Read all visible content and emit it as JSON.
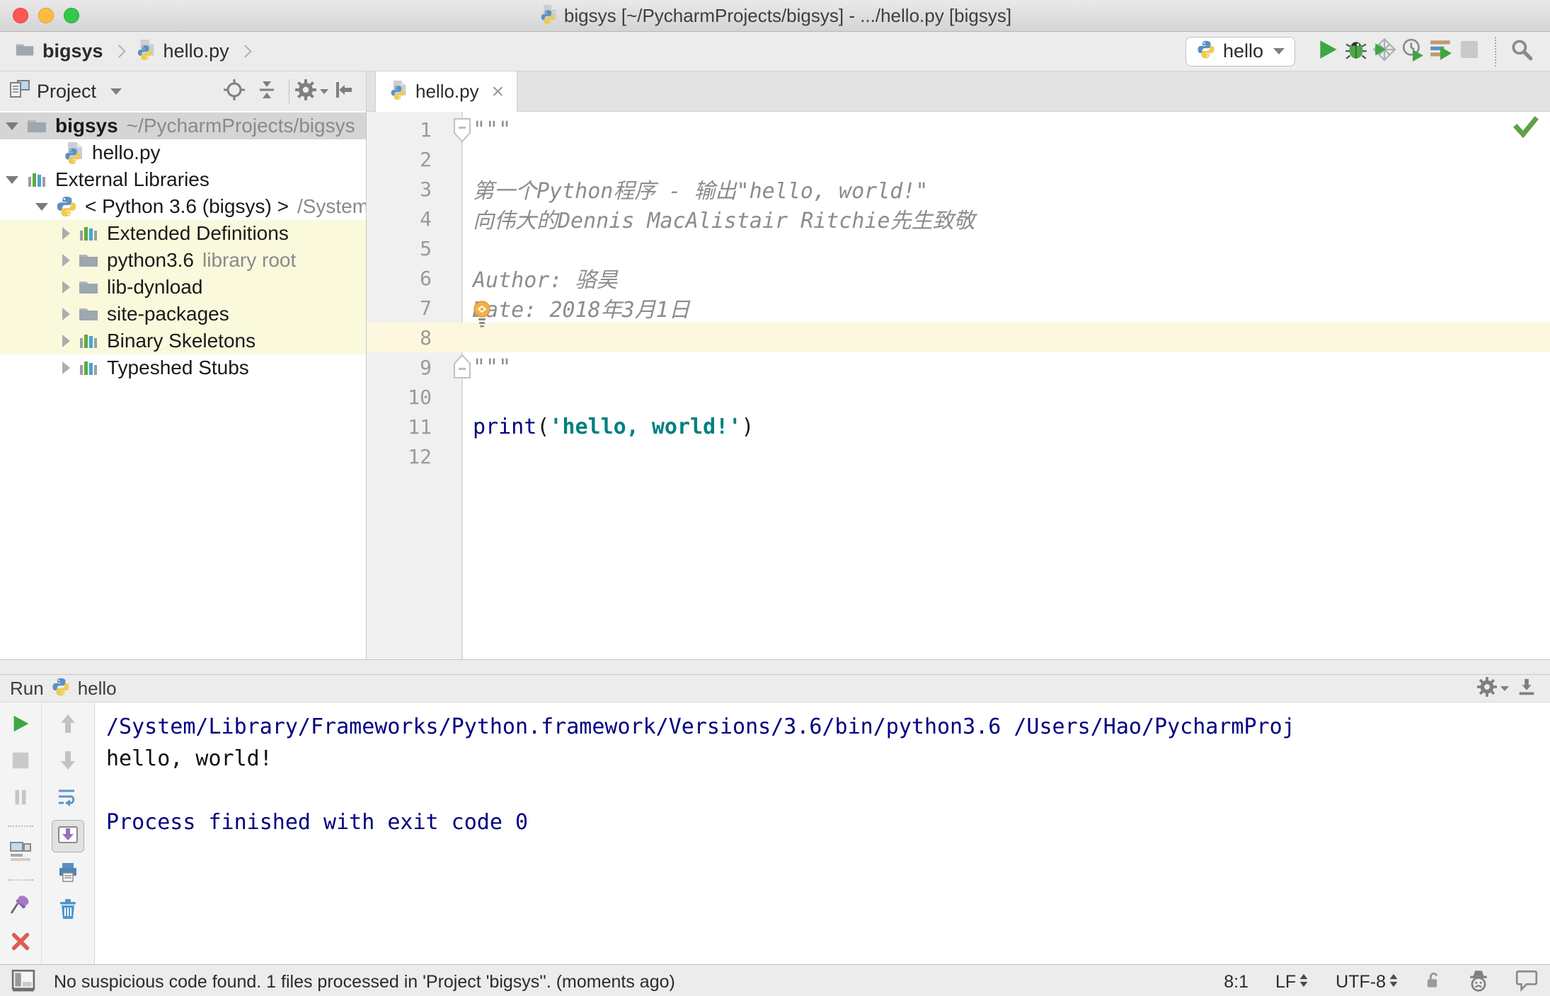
{
  "window": {
    "title": "bigsys [~/PycharmProjects/bigsys] - .../hello.py [bigsys]"
  },
  "toolbar": {
    "breadcrumbs": [
      "bigsys",
      "hello.py"
    ],
    "run_config": "hello"
  },
  "project": {
    "title": "Project",
    "tree": [
      {
        "label": "bigsys",
        "hint": "~/PycharmProjects/bigsys",
        "icon": "folder",
        "pad": 8,
        "arrow": "down",
        "selected": true,
        "bold": true
      },
      {
        "label": "hello.py",
        "hint": "",
        "icon": "python-file",
        "pad": 88,
        "arrow": null
      },
      {
        "label": "External Libraries",
        "hint": "",
        "icon": "library",
        "pad": 8,
        "arrow": "down"
      },
      {
        "label": "< Python 3.6 (bigsys) >",
        "hint": "/System",
        "icon": "python",
        "pad": 50,
        "arrow": "down"
      },
      {
        "label": "Extended Definitions",
        "hint": "",
        "icon": "library",
        "pad": 88,
        "arrow": "right",
        "lib": true
      },
      {
        "label": "python3.6",
        "hint": "library root",
        "icon": "folder",
        "pad": 88,
        "arrow": "right",
        "lib": true
      },
      {
        "label": "lib-dynload",
        "hint": "",
        "icon": "folder",
        "pad": 88,
        "arrow": "right",
        "lib": true
      },
      {
        "label": "site-packages",
        "hint": "",
        "icon": "folder",
        "pad": 88,
        "arrow": "right",
        "lib": true
      },
      {
        "label": "Binary Skeletons",
        "hint": "",
        "icon": "library",
        "pad": 88,
        "arrow": "right",
        "lib": true
      },
      {
        "label": "Typeshed Stubs",
        "hint": "",
        "icon": "library",
        "pad": 88,
        "arrow": "right"
      }
    ]
  },
  "editor": {
    "tab": "hello.py",
    "close_glyph": "×",
    "lines": [
      {
        "n": "1",
        "segments": [
          {
            "t": "\"\"\"",
            "c": "doc"
          }
        ]
      },
      {
        "n": "2",
        "segments": []
      },
      {
        "n": "3",
        "segments": [
          {
            "t": "第一个Python程序 - 输出\"hello, world!\"",
            "c": "doc"
          }
        ]
      },
      {
        "n": "4",
        "segments": [
          {
            "t": "向伟大的Dennis MacAlistair Ritchie先生致敬",
            "c": "doc"
          }
        ]
      },
      {
        "n": "5",
        "segments": []
      },
      {
        "n": "6",
        "segments": [
          {
            "t": "Author: 骆昊",
            "c": "doc"
          }
        ]
      },
      {
        "n": "7",
        "segments": [
          {
            "t": "Date: 2018年3月1日",
            "c": "doc"
          }
        ]
      },
      {
        "n": "8",
        "segments": [],
        "current": true
      },
      {
        "n": "9",
        "segments": [
          {
            "t": "\"\"\"",
            "c": "doc"
          }
        ]
      },
      {
        "n": "10",
        "segments": []
      },
      {
        "n": "11",
        "segments": [
          {
            "t": "print",
            "c": "kw"
          },
          {
            "t": "(",
            "c": "plain"
          },
          {
            "t": "'hello, world!'",
            "c": "str"
          },
          {
            "t": ")",
            "c": "plain"
          }
        ]
      },
      {
        "n": "12",
        "segments": []
      }
    ]
  },
  "run": {
    "title": "Run",
    "config": "hello",
    "more_glyph": "››",
    "console": [
      {
        "text": "/System/Library/Frameworks/Python.framework/Versions/3.6/bin/python3.6 /Users/Hao/PycharmProj",
        "type": "system"
      },
      {
        "text": "hello, world!",
        "type": "stdout"
      },
      {
        "text": "",
        "type": "stdout"
      },
      {
        "text": "Process finished with exit code 0",
        "type": "system"
      }
    ]
  },
  "statusbar": {
    "message": "No suspicious code found. 1 files processed in 'Project 'bigsys''. (moments ago)",
    "caret_position": "8:1",
    "line_separator": "LF",
    "encoding": "UTF-8"
  },
  "colors": {
    "accent_green": "#3ea642",
    "selection_gray": "#d5d5d5",
    "library_row_yellow": "#faf9dc",
    "current_line_yellow": "#fcf7de",
    "keyword_blue": "#000080",
    "string_teal": "#008080",
    "comment_gray": "#8c8c8c",
    "console_system_blue": "#000080"
  }
}
